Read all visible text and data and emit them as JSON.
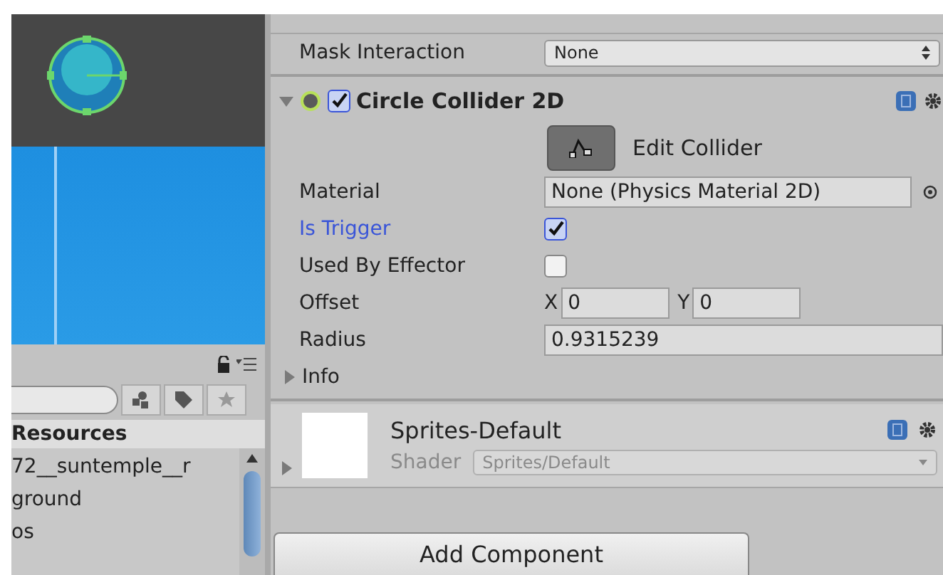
{
  "project": {
    "folder": "Resources",
    "items": [
      {
        "name": "72__suntemple__r"
      },
      {
        "name": "ground"
      },
      {
        "name": "os"
      }
    ]
  },
  "inspector": {
    "mask_interaction": {
      "label": "Mask Interaction",
      "value": "None"
    },
    "component": {
      "title": "Circle Collider 2D",
      "expanded": true,
      "enabled": true,
      "edit_button": "Edit Collider",
      "fields": [
        {
          "kind": "object",
          "label": "Material",
          "value": "None (Physics Material 2D)",
          "highlighted": false
        },
        {
          "kind": "checkbox",
          "label": "Is Trigger",
          "checked": true,
          "highlighted": true
        },
        {
          "kind": "checkbox",
          "label": "Used By Effector",
          "checked": false,
          "highlighted": false
        },
        {
          "kind": "vector",
          "label": "Offset",
          "axes": [
            {
              "axis": "X",
              "value": "0"
            },
            {
              "axis": "Y",
              "value": "0"
            }
          ],
          "highlighted": false
        },
        {
          "kind": "number",
          "label": "Radius",
          "value": "0.9315239",
          "highlighted": false
        },
        {
          "kind": "foldout",
          "label": "Info",
          "expanded": false,
          "highlighted": false
        }
      ]
    },
    "material": {
      "name": "Sprites-Default",
      "expanded": false,
      "shader_label": "Shader",
      "shader": "Sprites/Default"
    },
    "add_component_button": "Add Component"
  }
}
